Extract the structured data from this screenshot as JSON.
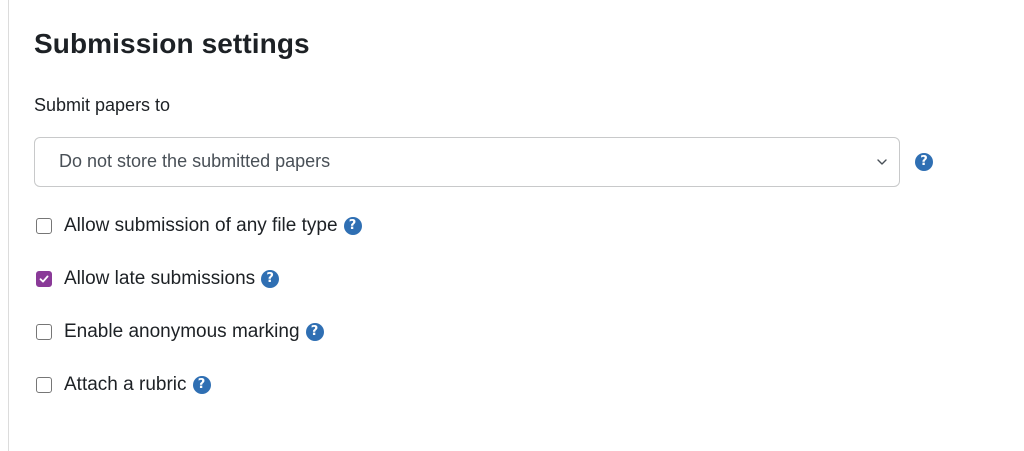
{
  "section": {
    "title": "Submission settings"
  },
  "submit_papers": {
    "label": "Submit papers to",
    "selected": "Do not store the submitted papers"
  },
  "help_glyph": "?",
  "options": [
    {
      "label": "Allow submission of any file type",
      "checked": false
    },
    {
      "label": "Allow late submissions",
      "checked": true
    },
    {
      "label": "Enable anonymous marking",
      "checked": false
    },
    {
      "label": "Attach a rubric",
      "checked": false
    }
  ],
  "colors": {
    "checked_fill": "#8a3a98",
    "help_icon": "#2f6fb3"
  }
}
